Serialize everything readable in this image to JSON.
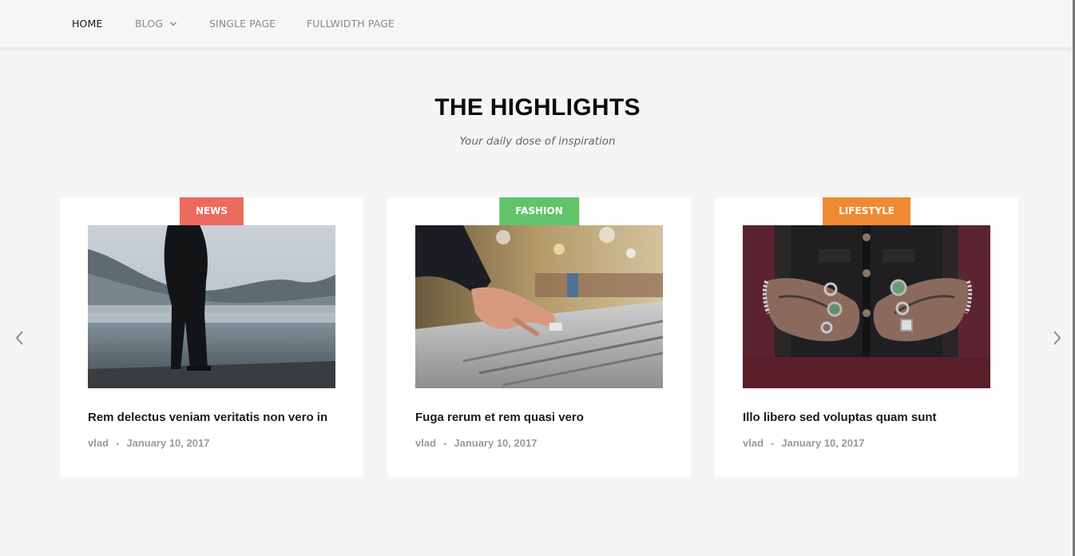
{
  "nav": {
    "items": [
      {
        "label": "HOME",
        "active": true
      },
      {
        "label": "BLOG",
        "has_dropdown": true
      },
      {
        "label": "SINGLE PAGE"
      },
      {
        "label": "FULLWIDTH PAGE"
      }
    ]
  },
  "highlights": {
    "title": "THE HIGHLIGHTS",
    "subtitle": "Your daily dose of inspiration"
  },
  "carousel": {
    "prev_icon": "chevron-left-icon",
    "next_icon": "chevron-right-icon"
  },
  "posts": [
    {
      "category": "NEWS",
      "category_color": "#ec6a5e",
      "title": "Rem delectus veniam veritatis non vero in",
      "author": "vlad",
      "separator": "-",
      "date": "January 10, 2017",
      "image": "man-standing-on-misty-lake-pier"
    },
    {
      "category": "FASHION",
      "category_color": "#62c46a",
      "title": "Fuga rerum et rem quasi vero",
      "author": "vlad",
      "separator": "-",
      "date": "January 10, 2017",
      "image": "hand-on-audio-mixing-console"
    },
    {
      "category": "LIFESTYLE",
      "category_color": "#ee8a34",
      "title": "Illo libero sed voluptas quam sunt",
      "author": "vlad",
      "separator": "-",
      "date": "January 10, 2017",
      "image": "tattooed-hands-with-rings"
    }
  ]
}
